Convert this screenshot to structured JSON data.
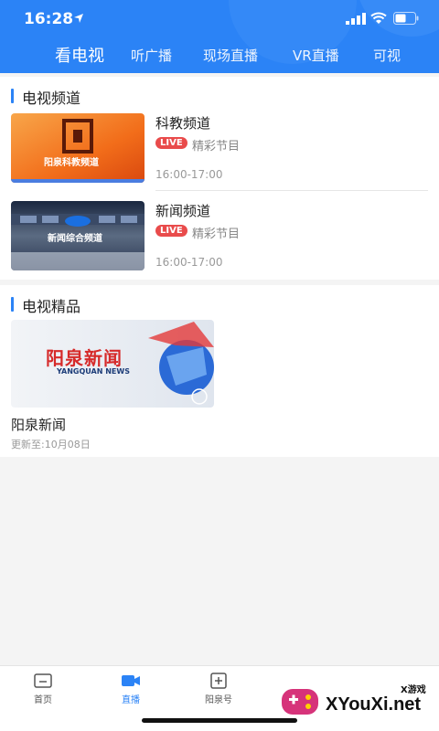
{
  "status": {
    "time": "16:28"
  },
  "tabs": [
    {
      "label": "看电视",
      "active": true
    },
    {
      "label": "听广播"
    },
    {
      "label": "现场直播"
    },
    {
      "label": "VR直播"
    },
    {
      "label": "可视"
    }
  ],
  "tv_channels": {
    "title": "电视频道",
    "items": [
      {
        "name": "科教频道",
        "badge": "LIVE",
        "desc": "精彩节目",
        "time": "16:00-17:00",
        "thumb_text": "阳泉科教频道"
      },
      {
        "name": "新闻频道",
        "badge": "LIVE",
        "desc": "精彩节目",
        "time": "16:00-17:00",
        "thumb_text": "新闻综合频道"
      }
    ]
  },
  "featured": {
    "title": "电视精品",
    "item": {
      "title": "阳泉新闻",
      "update": "更新至:10月08日",
      "thumb_cn": "阳泉新闻",
      "thumb_en": "YANGQUAN NEWS"
    }
  },
  "bottom_nav": [
    {
      "label": "首页",
      "icon": "home-icon"
    },
    {
      "label": "直播",
      "icon": "live-camera-icon",
      "active": true
    },
    {
      "label": "阳泉号",
      "icon": "plus-box-icon"
    }
  ],
  "watermark": {
    "small": "X游戏",
    "big": "XYouXi.net"
  },
  "colors": {
    "primary": "#2b83f6",
    "live": "#e94b4b"
  }
}
